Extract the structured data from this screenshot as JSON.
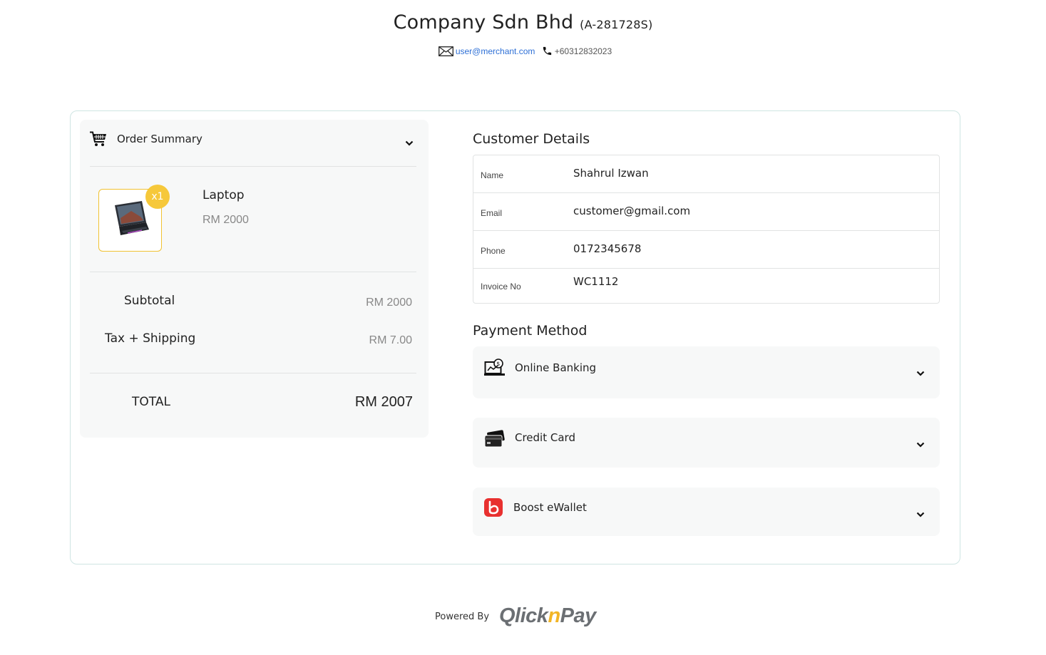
{
  "merchant": {
    "name": "Company Sdn Bhd",
    "reg_no": "(A-281728S)",
    "email": "user@merchant.com",
    "phone": "+60312832023"
  },
  "order_summary": {
    "title": "Order Summary",
    "item": {
      "name": "Laptop",
      "price": "RM 2000",
      "quantity": "x1"
    },
    "subtotal_label": "Subtotal",
    "subtotal_value": "RM 2000",
    "tax_label": "Tax + Shipping",
    "tax_value": "RM 7.00",
    "total_label": "TOTAL",
    "total_value": "RM 2007"
  },
  "customer": {
    "title": "Customer Details",
    "rows": [
      {
        "label": "Name",
        "value": "Shahrul Izwan"
      },
      {
        "label": "Email",
        "value": "customer@gmail.com"
      },
      {
        "label": "Phone",
        "value": "0172345678"
      },
      {
        "label": "Invoice No",
        "value": "WC1112"
      }
    ]
  },
  "payment": {
    "title": "Payment Method",
    "methods": [
      {
        "label": "Online Banking",
        "icon": "online-banking-icon"
      },
      {
        "label": "Credit Card",
        "icon": "credit-card-icon"
      },
      {
        "label": "Boost eWallet",
        "icon": "boost-ewallet-icon"
      }
    ]
  },
  "footer": {
    "powered_by": "Powered By",
    "brand_left": "Qlick",
    "brand_mid": "n",
    "brand_right": "Pay"
  },
  "colors": {
    "accent_yellow": "#f6c83a",
    "link_blue": "#2d6fd6",
    "card_border": "#cfe5e3",
    "panel_bg": "#f7f8f8"
  }
}
